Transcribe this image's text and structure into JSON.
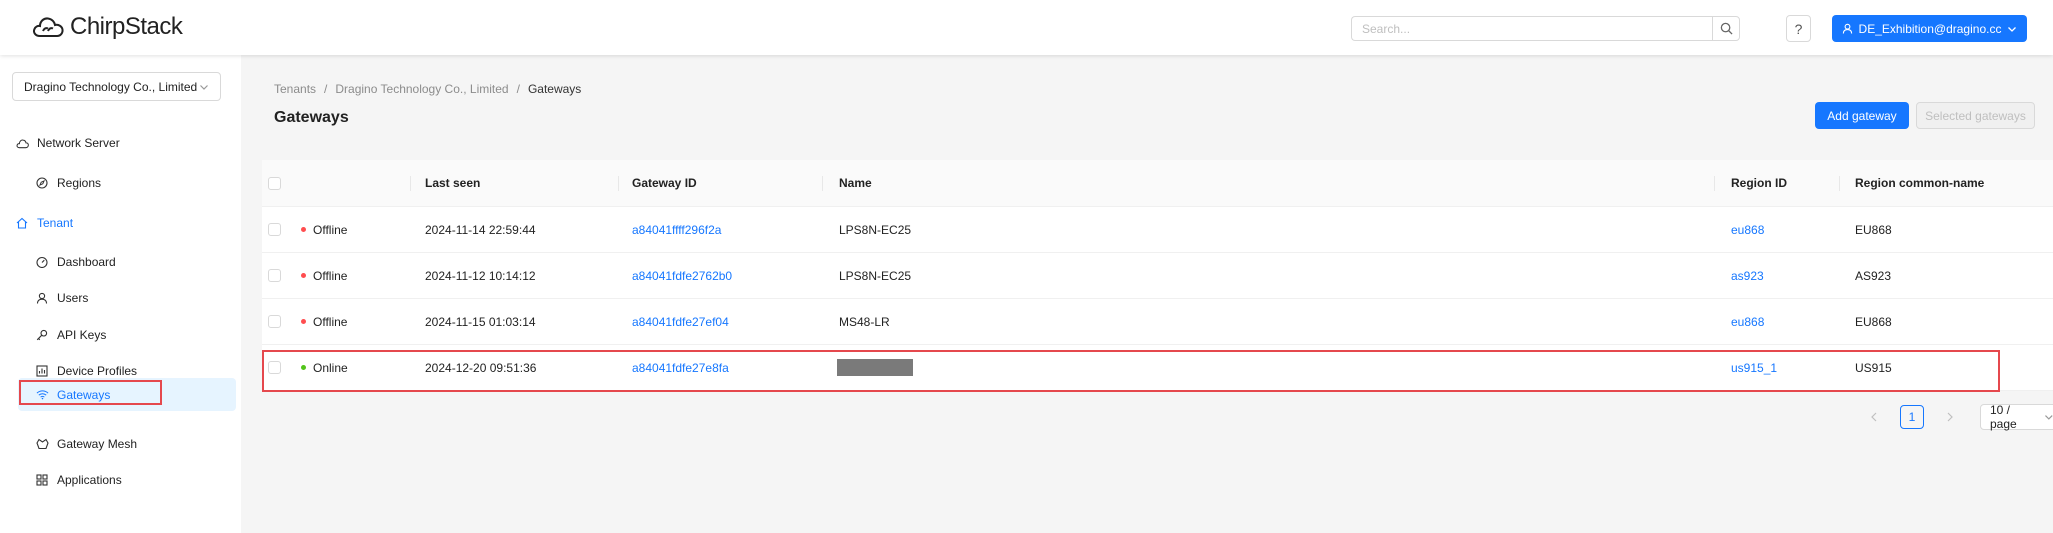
{
  "app": {
    "name": "ChirpStack"
  },
  "header": {
    "search_placeholder": "Search...",
    "help_label": "?",
    "user_label": "DE_Exhibition@dragino.cc"
  },
  "sidebar": {
    "tenant": "Dragino Technology Co., Limited",
    "network_server": "Network Server",
    "regions": "Regions",
    "tenant_group": "Tenant",
    "items": {
      "dashboard": "Dashboard",
      "users": "Users",
      "api_keys": "API Keys",
      "device_profiles": "Device Profiles",
      "gateways": "Gateways",
      "gateway_mesh": "Gateway Mesh",
      "applications": "Applications"
    }
  },
  "breadcrumb": {
    "b1": "Tenants",
    "b2": "Dragino Technology Co., Limited",
    "b3": "Gateways",
    "sep": "/"
  },
  "page": {
    "title": "Gateways",
    "add_button": "Add gateway",
    "selected_button": "Selected gateways"
  },
  "table": {
    "columns": {
      "last_seen": "Last seen",
      "gateway_id": "Gateway ID",
      "name": "Name",
      "region_id": "Region ID",
      "region_common_name": "Region common-name"
    },
    "rows": [
      {
        "status": "Offline",
        "last_seen": "2024-11-14 22:59:44",
        "gateway_id": "a84041ffff296f2a",
        "name": "LPS8N-EC25",
        "region_id": "eu868",
        "region_common_name": "EU868"
      },
      {
        "status": "Offline",
        "last_seen": "2024-11-12 10:14:12",
        "gateway_id": "a84041fdfe2762b0",
        "name": "LPS8N-EC25",
        "region_id": "as923",
        "region_common_name": "AS923"
      },
      {
        "status": "Offline",
        "last_seen": "2024-11-15 01:03:14",
        "gateway_id": "a84041fdfe27ef04",
        "name": "MS48-LR",
        "region_id": "eu868",
        "region_common_name": "EU868"
      },
      {
        "status": "Online",
        "last_seen": "2024-12-20 09:51:36",
        "gateway_id": "a84041fdfe27e8fa",
        "name": "",
        "region_id": "us915_1",
        "region_common_name": "US915"
      }
    ]
  },
  "pagination": {
    "current_page": "1",
    "page_size": "10 / page"
  },
  "colors": {
    "primary": "#1677ff",
    "offline": "#ff4d4f",
    "online": "#52c41a",
    "highlight": "#e5484d"
  }
}
